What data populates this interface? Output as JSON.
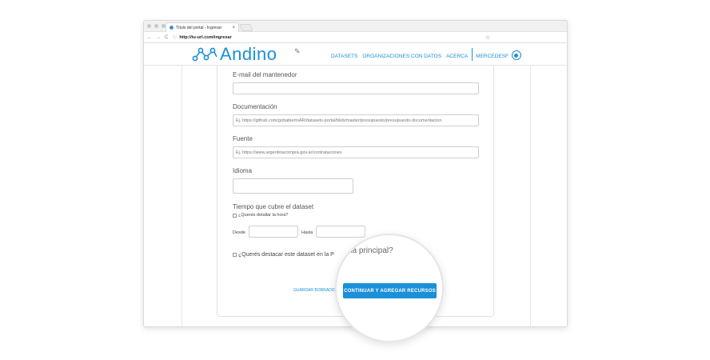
{
  "browser": {
    "tab_title": "Título del portal - Ingresar",
    "tab_close": "×",
    "url": "http://tu-url.com/ingresar",
    "nav_back": "←",
    "nav_forward": "→",
    "nav_reload": "C",
    "info_icon": "ⓘ",
    "star": "☆"
  },
  "header": {
    "logo_text": "Andino",
    "edit_icon": "✎",
    "nav_items": [
      "DATASETS",
      "ORGANIZACIONES CON DATOS",
      "ACERCA"
    ],
    "user": "MERCEDESF"
  },
  "form": {
    "email_label": "E-mail del mantenedor",
    "email_value": "",
    "doc_label": "Documentación",
    "doc_placeholder": "Ej. https://github.com/gobabiertoAR/datasets-portal/blob/master/presupuesto/presupuesto-documentacion",
    "source_label": "Fuente",
    "source_placeholder": "Ej. https://www.argentinacompra.gov.ar/contrataciones",
    "language_label": "Idioma",
    "language_value": "",
    "coverage_label": "Tiempo que cubre el dataset",
    "detail_hour_label": "¿Querés detallar la hora?",
    "from_label": "Desde",
    "to_label": "Hasta",
    "featured_label": "¿Querés destacar este dataset en la P",
    "save_draft_label": "GUARDAR BORRADO",
    "lens_fragment": "na principal?",
    "continue_label": "CONTINUAR Y AGREGAR RECURSOS"
  }
}
